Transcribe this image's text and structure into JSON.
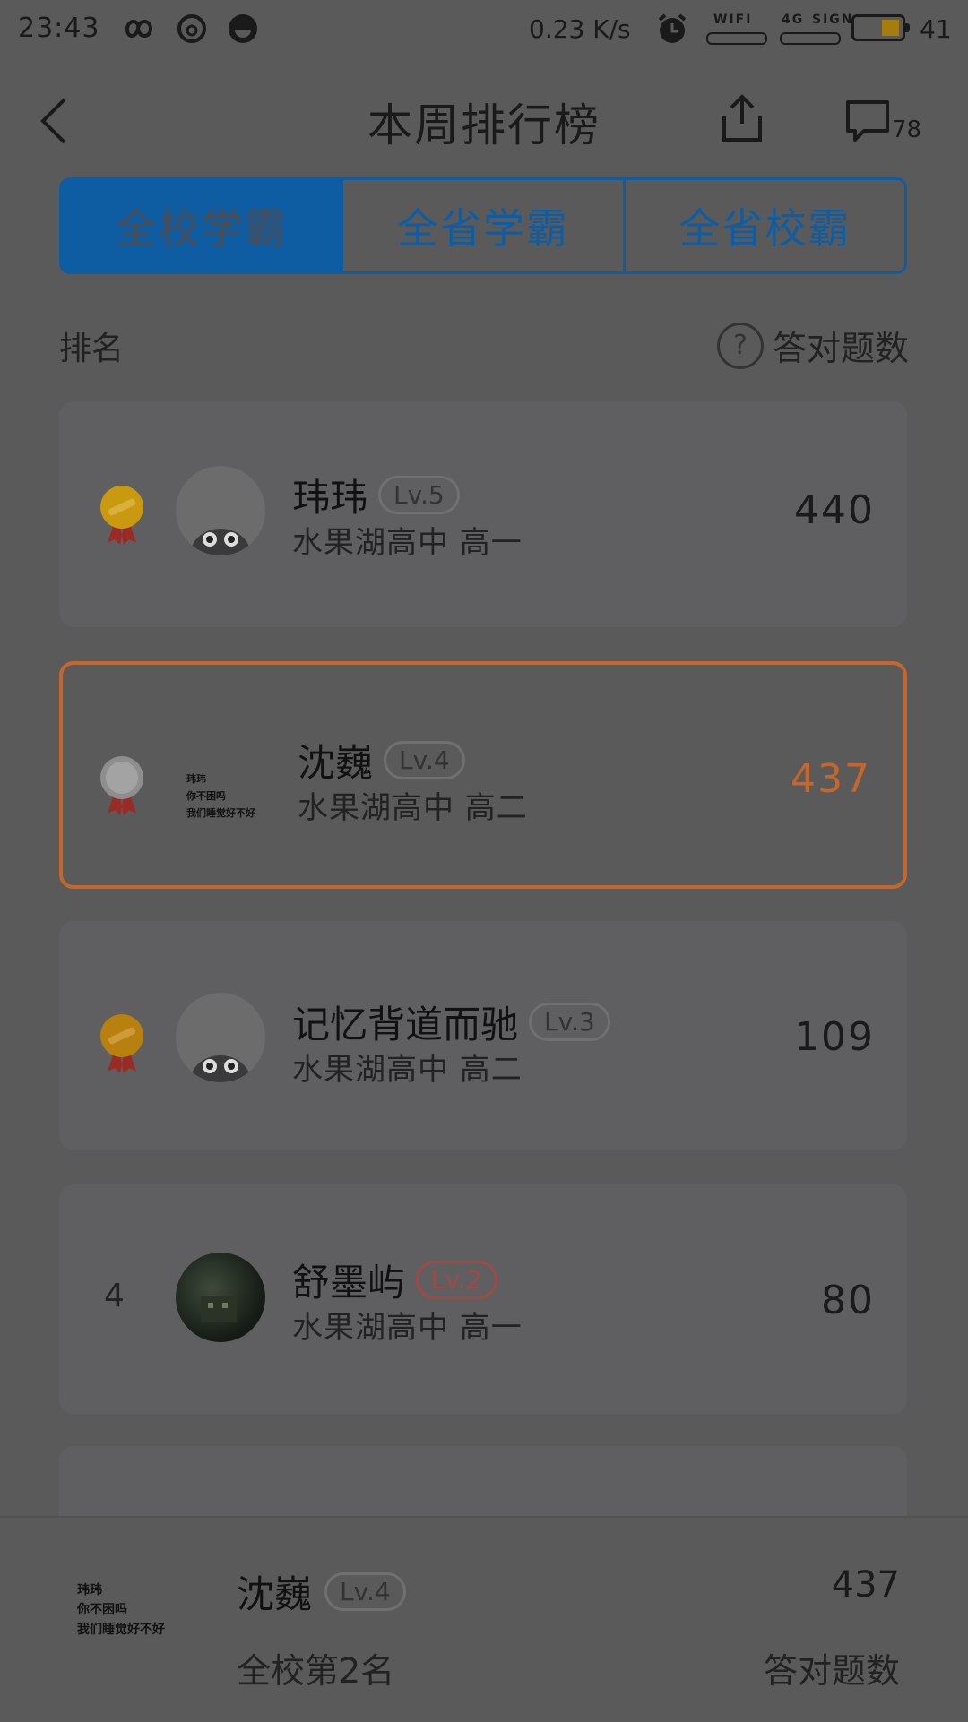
{
  "status_bar": {
    "time": "23:43",
    "net_speed": "0.23 K/s",
    "wifi_label": "WIFI",
    "net_type": "4G",
    "signal_label": "SIGN",
    "battery": "41",
    "battery_level": 0.41
  },
  "header": {
    "title": "本周排行榜",
    "comment_count": "78"
  },
  "tabs": [
    {
      "label": "全校学霸",
      "active": true
    },
    {
      "label": "全省学霸",
      "active": false
    },
    {
      "label": "全省校霸",
      "active": false
    }
  ],
  "columns": {
    "rank": "排名",
    "help": "?",
    "score": "答对题数"
  },
  "rows": [
    {
      "rank": "1",
      "medal": "gold",
      "name": "玮玮",
      "level": "Lv.5",
      "school": "水果湖高中 高一",
      "score": "440"
    },
    {
      "rank": "2",
      "medal": "silver",
      "name": "沈巍",
      "level": "Lv.4",
      "school": "水果湖高中 高二",
      "score": "437",
      "highlight": true,
      "avatar_text": [
        "玮玮",
        "你不困吗",
        "我们睡觉好不好"
      ]
    },
    {
      "rank": "3",
      "medal": "bronze",
      "name": "记忆背道而驰",
      "level": "Lv.3",
      "school": "水果湖高中 高二",
      "score": "109"
    },
    {
      "rank": "4",
      "name": "舒墨屿",
      "level": "Lv.2",
      "school": "水果湖高中 高一",
      "score": "80"
    }
  ],
  "me": {
    "avatar_text": [
      "玮玮",
      "你不困吗",
      "我们睡觉好不好"
    ],
    "name": "沈巍",
    "level": "Lv.4",
    "rank_text": "全校第2名",
    "score": "437",
    "score_label": "答对题数"
  },
  "colors": {
    "accent_blue": "#0e5da3",
    "highlight_orange": "#c7662a",
    "gold": "#c99a0f",
    "silver": "#8e8e8e"
  }
}
